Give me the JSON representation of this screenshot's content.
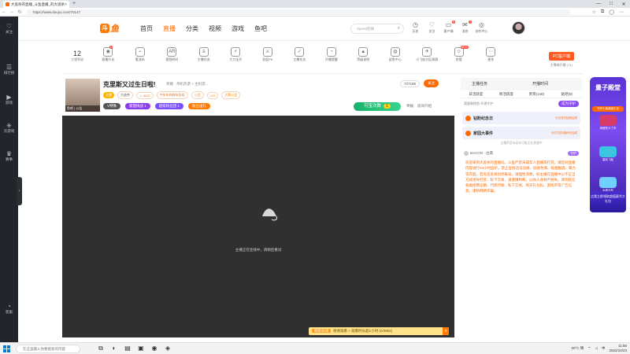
{
  "browser": {
    "tab_title": "大逃杀的直播_斗鱼直播_的大逃杀日...",
    "url": "https://www.douyu.com/70147",
    "tab_close": "×",
    "new_tab": "+",
    "back": "←",
    "forward": "→",
    "reload": "↻"
  },
  "left_sidebar": [
    {
      "icon": "heart-icon",
      "glyph": "♡",
      "label": "关注"
    },
    {
      "icon": "list-icon",
      "glyph": "☰",
      "label": "排行榜"
    },
    {
      "icon": "play-icon",
      "glyph": "▶",
      "label": "游戏"
    },
    {
      "icon": "gamepad-icon",
      "glyph": "⎈",
      "label": "云游戏"
    },
    {
      "icon": "trophy-icon",
      "glyph": "♛",
      "label": "赛事"
    },
    {
      "icon": "headset-icon",
      "glyph": "◔",
      "label": "客服"
    }
  ],
  "site": {
    "logo_mark": "斗",
    "logo_word": "鱼",
    "nav": [
      "首页",
      "直播",
      "分类",
      "视频",
      "游戏",
      "鱼吧"
    ],
    "nav_active_index": 1,
    "search_placeholder": "Speed机械",
    "header_icons": [
      {
        "icon": "history-icon",
        "glyph": "◷",
        "label": "历史",
        "badge": ""
      },
      {
        "icon": "follow-icon",
        "glyph": "♡",
        "label": "关注",
        "badge": ""
      },
      {
        "icon": "client-icon",
        "glyph": "▭",
        "label": "客户端",
        "badge": "9"
      },
      {
        "icon": "message-icon",
        "glyph": "✉",
        "label": "消息",
        "badge": "1"
      },
      {
        "icon": "creator-icon",
        "glyph": "◎",
        "label": "创作中心",
        "badge": ""
      }
    ]
  },
  "room_toolbar": {
    "level": "12",
    "level_label": "主播等级",
    "tools": [
      {
        "label": "直播开关",
        "glyph": "◉",
        "badge": "2"
      },
      {
        "label": "看流码",
        "glyph": "⌁",
        "badge": ""
      },
      {
        "label": "视频转码",
        "glyph": "AR",
        "badge": ""
      },
      {
        "label": "主播任务",
        "glyph": "♙",
        "badge": ""
      },
      {
        "label": "大力全开",
        "glyph": "⚡",
        "badge": ""
      },
      {
        "label": "发起PK",
        "glyph": "⚔",
        "badge": ""
      },
      {
        "label": "主播任务",
        "glyph": "✓",
        "badge": ""
      },
      {
        "label": "开播提醒",
        "glyph": "◔",
        "badge": ""
      },
      {
        "label": "等级说明",
        "glyph": "▲",
        "badge": ""
      },
      {
        "label": "鲨鱼中心",
        "glyph": "◍",
        "badge": ""
      },
      {
        "label": "小飞船分区周赛",
        "glyph": "✈",
        "badge": ""
      },
      {
        "label": "房管",
        "glyph": "☺",
        "badge": "NEW"
      },
      {
        "label": "更多",
        "glyph": "⋯",
        "badge": ""
      }
    ],
    "pc_button": "PC客户端",
    "pc_sub": "主播端开播 (T1)"
  },
  "streamer": {
    "name": "克里斯又过生日啦!",
    "breadcrumb": "荣耀 · 单机热游 > 主机游...",
    "avatar_caption": "鱼吧 | 公告",
    "follow_count": "727186",
    "follow_label": "关注",
    "tags": [
      {
        "text": "主播",
        "bg": "#ffb400",
        "fg": "#fff"
      },
      {
        "text": "大逃杀",
        "bg": "#fff",
        "fg": "#555"
      },
      {
        "text": "♨ 4122",
        "bg": "#fff",
        "fg": "#ff6a00"
      },
      {
        "text": "今年年终跨年狂欢",
        "bg": "#fff",
        "fg": "#ff6a00"
      },
      {
        "text": "公会",
        "bg": "#fff",
        "fg": "#ff8800"
      },
      {
        "text": "LV5",
        "bg": "#fff",
        "fg": "#ff8800"
      },
      {
        "text": "大鹅公会",
        "bg": "#fff",
        "fg": "#ff8800"
      }
    ],
    "badges": [
      {
        "text": "V特殊",
        "bg": "#555"
      },
      {
        "text": "狐狸挑战  1",
        "bg": "#8a3df0"
      },
      {
        "text": "超级粉丝团 1",
        "bg": "#7a4dff"
      },
      {
        "text": "粉丝送礼",
        "bg": "#ff7a00"
      }
    ],
    "treasure_label": "可宝次数",
    "treasure_count": "1",
    "right_links": [
      "举报",
      "房间介绍"
    ]
  },
  "video": {
    "message": "主播正在连线中，请稍后重试",
    "gift_tag": "明星商城",
    "gift_text": "谢谢观看 > 观看时长超1小时 (0/3952)"
  },
  "right_panel": {
    "head": [
      "主播任务",
      "开播时间"
    ],
    "tabs": [
      "日活跃度",
      "周活跃度",
      "贵宾(140)",
      "贴吧(9)"
    ],
    "guard_text": "我要做榜首 开通守护",
    "guard_button": "成为守护",
    "cards": [
      {
        "name": "钻粉纪念日",
        "desc": "今日月打钻粉加成"
      },
      {
        "name": "家园大事件",
        "desc": "今日打钻3倍积分加成"
      }
    ],
    "note": "主播声音未成年可能正在直播中",
    "chat_user": "BACON · 古典",
    "chat_tag": "守护",
    "system_message": "欢迎来到大逃杀的直播间。斗鱼严禁未成年人直播或打赏，请您对直播内容进行24小时监护。禁止宣扬违法违规、低俗色情、吸烟酗酒、暴力等内容，若有违反将封停账号。请理性消费，如主播在直播中以不正当方式诱导打赏、私下交易，请谨慎判断，以防人身财产损失。请勿轻信各类招聘征婚、代练代聊、私下交易、购买礼包码、游戏币等广告信息，谨防网络诈骗。"
  },
  "promo": {
    "title": "量子殿堂",
    "ticket": "守护小鱼超级礼包",
    "items": [
      "海狸快卡丁车",
      "星际飞船",
      "水晶马车"
    ],
    "footer": "点我立即领取超值豪华大礼包"
  },
  "taskbar": {
    "search": "在这里输入你要搜索的内容",
    "temp": "20°C 晴",
    "lang": "中",
    "time": "11:50",
    "date": "2022/10/23"
  }
}
